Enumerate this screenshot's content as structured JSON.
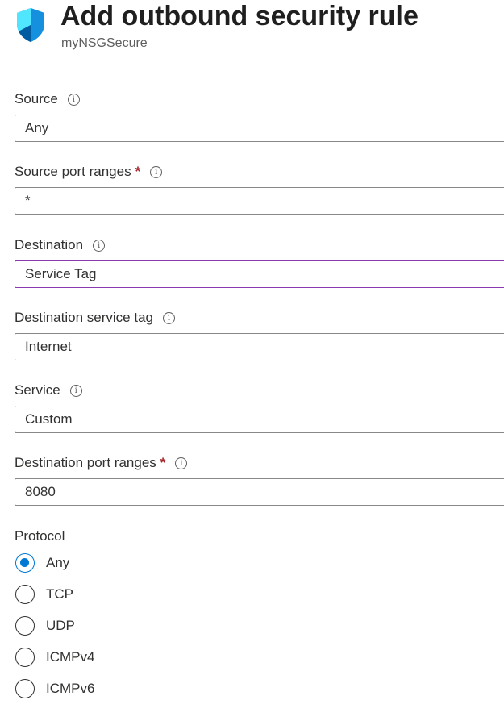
{
  "header": {
    "title": "Add outbound security rule",
    "subtitle": "myNSGSecure",
    "icon": "shield-icon",
    "icon_color": "#0078d4"
  },
  "fields": {
    "source": {
      "label": "Source",
      "value": "Any"
    },
    "source_port_ranges": {
      "label": "Source port ranges",
      "required": "*",
      "value": "*"
    },
    "destination": {
      "label": "Destination",
      "value": "Service Tag"
    },
    "destination_service_tag": {
      "label": "Destination service tag",
      "value": "Internet"
    },
    "service": {
      "label": "Service",
      "value": "Custom"
    },
    "destination_port_ranges": {
      "label": "Destination port ranges",
      "required": "*",
      "value": "8080"
    }
  },
  "info_glyph": "i",
  "protocol": {
    "label": "Protocol",
    "selected": "Any",
    "options": [
      "Any",
      "TCP",
      "UDP",
      "ICMPv4",
      "ICMPv6"
    ]
  },
  "colors": {
    "accent": "#0078d4",
    "focus_border": "#8a3aaf",
    "required": "#a4262c"
  }
}
